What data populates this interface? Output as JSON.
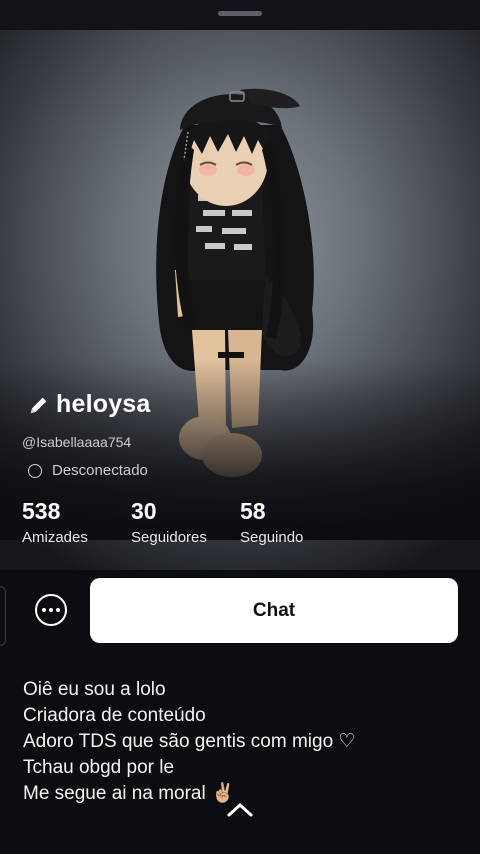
{
  "profile": {
    "display_name": "heloysa",
    "username": "@Isabellaaaa754",
    "presence": "Desconectado"
  },
  "stats": [
    {
      "value": "538",
      "label": "Amizades"
    },
    {
      "value": "30",
      "label": "Seguidores"
    },
    {
      "value": "58",
      "label": "Seguindo"
    }
  ],
  "actions": {
    "chat_label": "Chat"
  },
  "bio": [
    "Oiê eu sou a lolo",
    "Criadora de conteúdo",
    "Adoro TDS que são gentis com migo ♡",
    "Tchau obgd por le",
    "Me segue ai na moral ✌🏼"
  ],
  "icons": {
    "edit": "pencil-icon",
    "presence": "offline-circle-icon",
    "more": "more-options-icon",
    "expand": "chevron-up-icon"
  }
}
